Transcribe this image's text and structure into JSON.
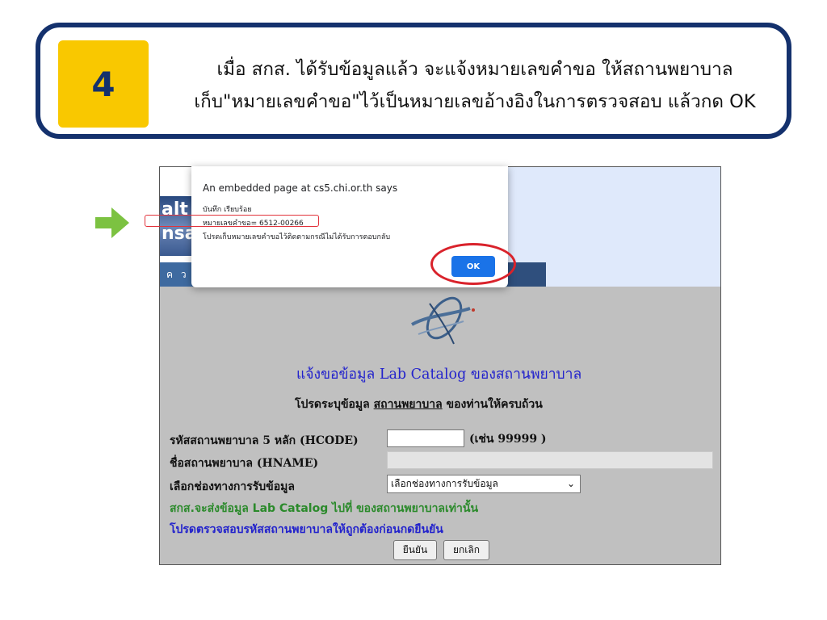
{
  "step": {
    "number": "4",
    "line1": "เมื่อ สกส. ได้รับข้อมูลแล้ว จะแจ้งหมายเลขคำขอ ให้สถานพยาบาล",
    "line2": "เก็บ\"หมายเลขคำขอ\"ไว้เป็นหมายเลขอ้างอิงในการตรวจสอบ แล้วกด OK"
  },
  "header_partial": {
    "logo_fragment_1": "alt",
    "logo_fragment_2": "nsa",
    "nav_fragment": "ค ว"
  },
  "alert": {
    "title": "An embedded page at cs5.chi.or.th says",
    "line1": "บันทึก เรียบร้อย",
    "line2": "หมายเลขคำขอ= 6512-00266",
    "line3": "โปรดเก็บหมายเลขคำขอไว้ติดตามกรณีไม่ได้รับการตอบกลับ",
    "ok_label": "OK"
  },
  "form": {
    "heading": "แจ้งขอข้อมูล Lab Catalog ของสถานพยาบาล",
    "instruction_pre": "โปรดระบุข้อมูล ",
    "instruction_underlined": "สถานพยาบาล",
    "instruction_post": " ของท่านให้ครบถ้วน",
    "hcode_label": "รหัสสถานพยาบาล 5 หลัก (HCODE)",
    "hcode_value": "",
    "hcode_example": "(เช่น 99999 )",
    "hname_label": "ชื่อสถานพยาบาล (HNAME)",
    "hname_value": "",
    "channel_label": "เลือกช่องทางการรับข้อมูล",
    "channel_selected": "เลือกช่องทางการรับข้อมูล",
    "note_green": "สกส.จะส่งข้อมูล Lab Catalog ไปที่ ของสถานพยาบาลเท่านั้น",
    "note_blue": "โปรดตรวจสอบรหัสสถานพยาบาลให้ถูกต้องก่อนกดยืนยัน",
    "confirm_label": "ยืนยัน",
    "cancel_label": "ยกเลิก"
  },
  "colors": {
    "banner_border": "#14316d",
    "step_box": "#f9c800",
    "highlight_red": "#d9222b",
    "arrow_green": "#7cc241",
    "ok_blue": "#1a73e8",
    "form_bg": "#c0c0c0"
  }
}
